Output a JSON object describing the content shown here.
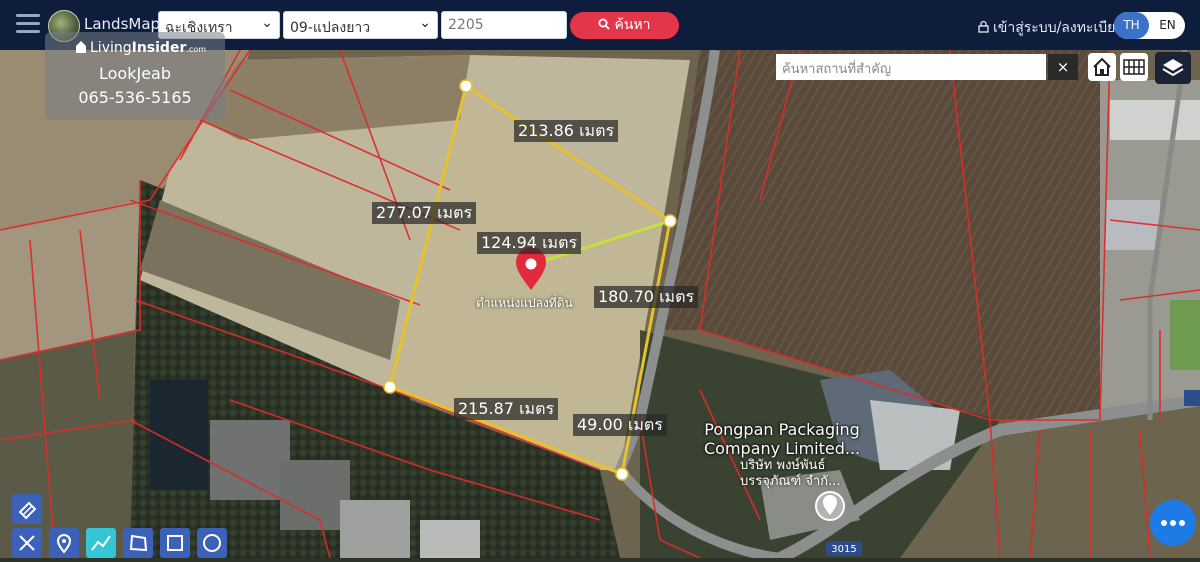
{
  "header": {
    "brand": "LandsMaps",
    "province": "ฉะเชิงเทรา",
    "district": "09-แปลงยาว",
    "parcel_number": "2205",
    "search_label": "ค้นหา",
    "login_label": "เข้าสู่ระบบ/ลงทะเบียน",
    "lang_th": "TH",
    "lang_en": "EN"
  },
  "agent": {
    "brand_bold": "Insider",
    "brand_prefix": "Living",
    "brand_suffix": ".com",
    "name": "LookJeab",
    "phone": "065-536-5165"
  },
  "place_search": {
    "placeholder": "ค้นหาสถานที่สำคัญ",
    "clear_label": "×"
  },
  "measurements": {
    "top": "213.86 เมตร",
    "left": "277.07 เมตร",
    "radius": "124.94 เมตร",
    "right": "180.70 เมตร",
    "bottom": "215.87 เมตร",
    "bottom_right": "49.00 เมตร"
  },
  "center_label": "ตำแหน่งแปลงที่ดิน",
  "company": {
    "name_line1": "Pongpan Packaging",
    "name_line2": "Company Limited...",
    "name_th_line1": "บริษัท พงษ์พันธ์",
    "name_th_line2": "บรรจุภัณฑ์ จำกั..."
  },
  "road_label": "3015",
  "colors": {
    "topbar": "#0f1d3d",
    "search_button": "#e3364a",
    "parcel_outline": "#e7c22c",
    "cadastral_lines": "#e02a2a",
    "tool_buttons": "#3c61b8",
    "chat_button": "#1e7be6"
  },
  "icons": [
    "menu-icon",
    "search-icon",
    "lock-icon",
    "home-icon",
    "grid-icon",
    "layers-icon",
    "eraser-icon",
    "ruler-icon",
    "pin-icon",
    "line-icon",
    "polygon-icon",
    "rectangle-icon",
    "circle-icon",
    "chat-icon",
    "location-pin-icon"
  ]
}
